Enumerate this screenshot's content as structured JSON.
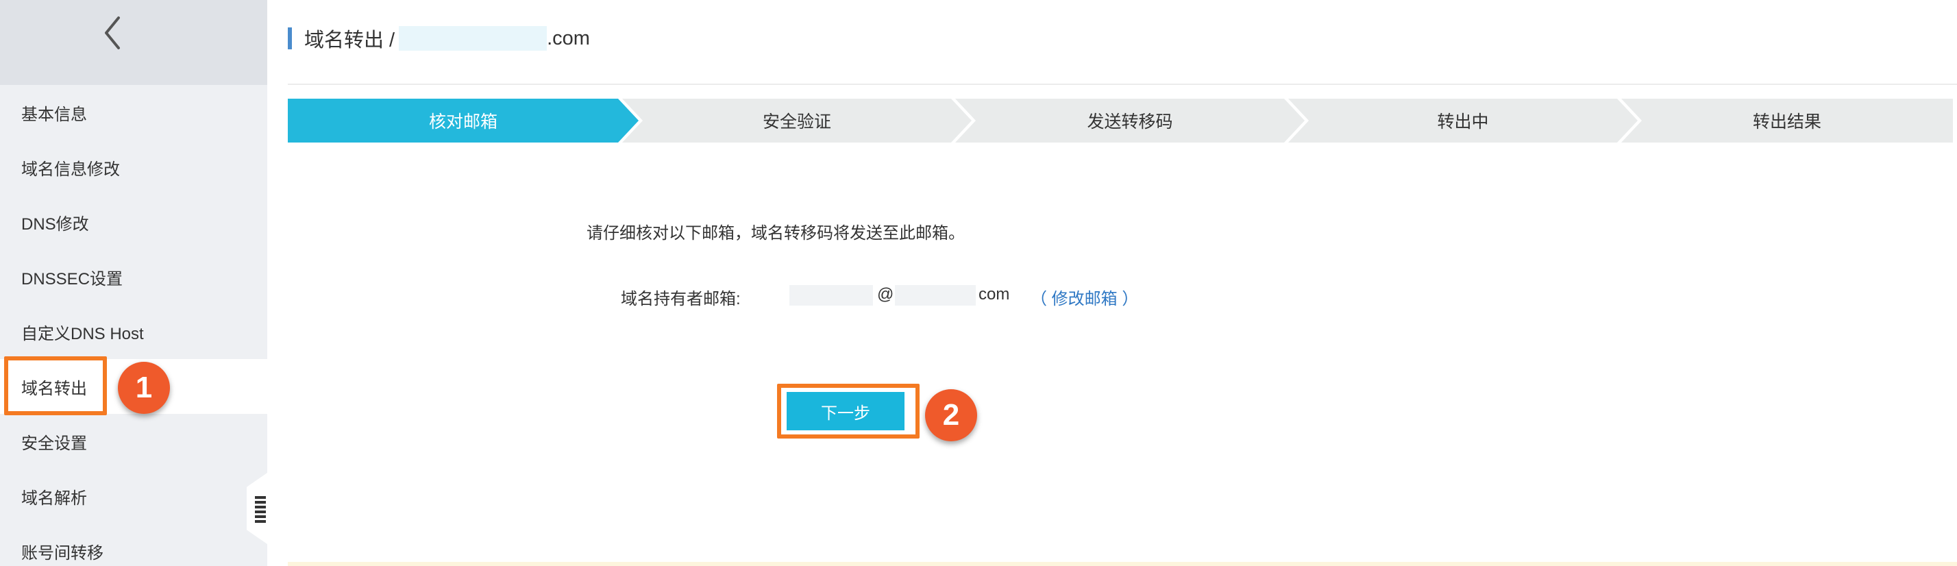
{
  "sidebar": {
    "items": [
      {
        "label": "基本信息"
      },
      {
        "label": "域名信息修改"
      },
      {
        "label": "DNS修改"
      },
      {
        "label": "DNSSEC设置"
      },
      {
        "label": "自定义DNS Host"
      },
      {
        "label": "域名转出"
      },
      {
        "label": "安全设置"
      },
      {
        "label": "域名解析"
      },
      {
        "label": "账号间转移"
      }
    ],
    "active_index": 5
  },
  "annotations": {
    "marker1": "1",
    "marker2": "2"
  },
  "header": {
    "breadcrumb_prefix": "域名转出 /",
    "breadcrumb_suffix": ".com"
  },
  "steps": [
    {
      "label": "核对邮箱",
      "active": true
    },
    {
      "label": "安全验证",
      "active": false
    },
    {
      "label": "发送转移码",
      "active": false
    },
    {
      "label": "转出中",
      "active": false
    },
    {
      "label": "转出结果",
      "active": false
    }
  ],
  "content": {
    "notice": "请仔细核对以下邮箱，域名转移码将发送至此邮箱。",
    "email_label": "域名持有者邮箱:",
    "email_at": "@",
    "email_com": "com",
    "modify_link": "（ 修改邮箱 ）",
    "next_button": "下一步"
  },
  "colors": {
    "accent": "#23b8dc",
    "annotation": "#f47a22",
    "marker": "#ef5a2b",
    "link": "#2f78c4"
  }
}
